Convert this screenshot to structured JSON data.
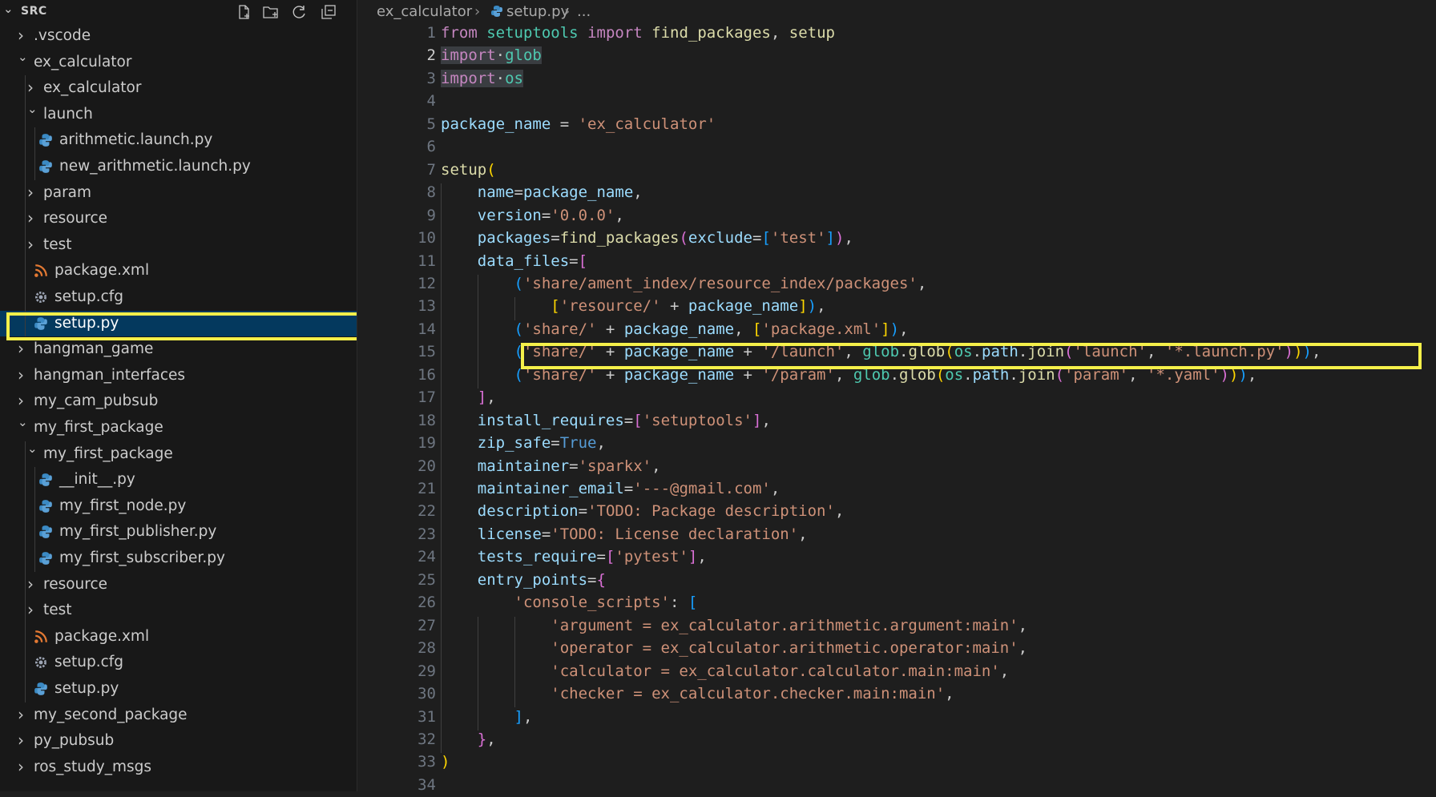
{
  "explorer": {
    "title": "SRC",
    "actions": [
      "new-file-icon",
      "new-folder-icon",
      "refresh-icon",
      "collapse-all-icon"
    ]
  },
  "tree": [
    {
      "label": ".vscode",
      "type": "folder",
      "expanded": false,
      "depth": 0
    },
    {
      "label": "ex_calculator",
      "type": "folder",
      "expanded": true,
      "depth": 0
    },
    {
      "label": "ex_calculator",
      "type": "folder",
      "expanded": false,
      "depth": 1
    },
    {
      "label": "launch",
      "type": "folder",
      "expanded": true,
      "depth": 1
    },
    {
      "label": "arithmetic.launch.py",
      "type": "py",
      "depth": 2
    },
    {
      "label": "new_arithmetic.launch.py",
      "type": "py",
      "depth": 2
    },
    {
      "label": "param",
      "type": "folder",
      "expanded": false,
      "depth": 1
    },
    {
      "label": "resource",
      "type": "folder",
      "expanded": false,
      "depth": 1
    },
    {
      "label": "test",
      "type": "folder",
      "expanded": false,
      "depth": 1
    },
    {
      "label": "package.xml",
      "type": "xml",
      "depth": 1
    },
    {
      "label": "setup.cfg",
      "type": "cfg",
      "depth": 1
    },
    {
      "label": "setup.py",
      "type": "py",
      "depth": 1,
      "selected": true
    },
    {
      "label": "hangman_game",
      "type": "folder",
      "expanded": false,
      "depth": 0
    },
    {
      "label": "hangman_interfaces",
      "type": "folder",
      "expanded": false,
      "depth": 0
    },
    {
      "label": "my_cam_pubsub",
      "type": "folder",
      "expanded": false,
      "depth": 0
    },
    {
      "label": "my_first_package",
      "type": "folder",
      "expanded": true,
      "depth": 0
    },
    {
      "label": "my_first_package",
      "type": "folder",
      "expanded": true,
      "depth": 1
    },
    {
      "label": "__init__.py",
      "type": "py",
      "depth": 2
    },
    {
      "label": "my_first_node.py",
      "type": "py",
      "depth": 2
    },
    {
      "label": "my_first_publisher.py",
      "type": "py",
      "depth": 2
    },
    {
      "label": "my_first_subscriber.py",
      "type": "py",
      "depth": 2
    },
    {
      "label": "resource",
      "type": "folder",
      "expanded": false,
      "depth": 1
    },
    {
      "label": "test",
      "type": "folder",
      "expanded": false,
      "depth": 1
    },
    {
      "label": "package.xml",
      "type": "xml",
      "depth": 1
    },
    {
      "label": "setup.cfg",
      "type": "cfg",
      "depth": 1
    },
    {
      "label": "setup.py",
      "type": "py",
      "depth": 1
    },
    {
      "label": "my_second_package",
      "type": "folder",
      "expanded": false,
      "depth": 0
    },
    {
      "label": "py_pubsub",
      "type": "folder",
      "expanded": false,
      "depth": 0
    },
    {
      "label": "ros_study_msgs",
      "type": "folder",
      "expanded": false,
      "depth": 0
    }
  ],
  "breadcrumb": {
    "folder": "ex_calculator",
    "file": "setup.py",
    "rest": "..."
  },
  "editor": {
    "active_line": 2,
    "lines": [
      [
        [
          "k",
          "from"
        ],
        [
          "p",
          " "
        ],
        [
          "m",
          "setuptools"
        ],
        [
          "p",
          " "
        ],
        [
          "k",
          "import"
        ],
        [
          "p",
          " "
        ],
        [
          "f",
          "find_packages"
        ],
        [
          "p",
          ", "
        ],
        [
          "f",
          "setup"
        ]
      ],
      [
        [
          "k",
          "import"
        ],
        [
          "p",
          "·"
        ],
        [
          "m",
          "glob"
        ]
      ],
      [
        [
          "k",
          "import"
        ],
        [
          "p",
          "·"
        ],
        [
          "m",
          "os"
        ]
      ],
      [],
      [
        [
          "v",
          "package_name"
        ],
        [
          "p",
          " = "
        ],
        [
          "s",
          "'ex_calculator'"
        ]
      ],
      [],
      [
        [
          "f",
          "setup"
        ],
        [
          "b1",
          "("
        ]
      ],
      [
        [
          "p",
          "    "
        ],
        [
          "v",
          "name"
        ],
        [
          "p",
          "="
        ],
        [
          "v",
          "package_name"
        ],
        [
          "p",
          ","
        ]
      ],
      [
        [
          "p",
          "    "
        ],
        [
          "v",
          "version"
        ],
        [
          "p",
          "="
        ],
        [
          "s",
          "'0.0.0'"
        ],
        [
          "p",
          ","
        ]
      ],
      [
        [
          "p",
          "    "
        ],
        [
          "v",
          "packages"
        ],
        [
          "p",
          "="
        ],
        [
          "f",
          "find_packages"
        ],
        [
          "b2",
          "("
        ],
        [
          "v",
          "exclude"
        ],
        [
          "p",
          "="
        ],
        [
          "b3",
          "["
        ],
        [
          "s",
          "'test'"
        ],
        [
          "b3",
          "]"
        ],
        [
          "b2",
          ")"
        ],
        [
          "p",
          ","
        ]
      ],
      [
        [
          "p",
          "    "
        ],
        [
          "v",
          "data_files"
        ],
        [
          "p",
          "="
        ],
        [
          "b2",
          "["
        ]
      ],
      [
        [
          "p",
          "        "
        ],
        [
          "b3",
          "("
        ],
        [
          "s",
          "'share/ament_index/resource_index/packages'"
        ],
        [
          "p",
          ","
        ]
      ],
      [
        [
          "p",
          "            "
        ],
        [
          "b1",
          "["
        ],
        [
          "s",
          "'resource/'"
        ],
        [
          "p",
          " + "
        ],
        [
          "v",
          "package_name"
        ],
        [
          "b1",
          "]"
        ],
        [
          "b3",
          ")"
        ],
        [
          "p",
          ","
        ]
      ],
      [
        [
          "p",
          "        "
        ],
        [
          "b3",
          "("
        ],
        [
          "s",
          "'share/'"
        ],
        [
          "p",
          " + "
        ],
        [
          "v",
          "package_name"
        ],
        [
          "p",
          ", "
        ],
        [
          "b1",
          "["
        ],
        [
          "s",
          "'package.xml'"
        ],
        [
          "b1",
          "]"
        ],
        [
          "b3",
          ")"
        ],
        [
          "p",
          ","
        ]
      ],
      [
        [
          "p",
          "        "
        ],
        [
          "b3",
          "("
        ],
        [
          "s",
          "'share/'"
        ],
        [
          "p",
          " + "
        ],
        [
          "v",
          "package_name"
        ],
        [
          "p",
          " + "
        ],
        [
          "s",
          "'/launch'"
        ],
        [
          "p",
          ", "
        ],
        [
          "m",
          "glob"
        ],
        [
          "p",
          "."
        ],
        [
          "f",
          "glob"
        ],
        [
          "b1",
          "("
        ],
        [
          "m",
          "os"
        ],
        [
          "p",
          "."
        ],
        [
          "v",
          "path"
        ],
        [
          "p",
          "."
        ],
        [
          "f",
          "join"
        ],
        [
          "b2",
          "("
        ],
        [
          "s",
          "'launch'"
        ],
        [
          "p",
          ", "
        ],
        [
          "s",
          "'*.launch.py'"
        ],
        [
          "b2",
          ")"
        ],
        [
          "b1",
          ")"
        ],
        [
          "b3",
          ")"
        ],
        [
          "p",
          ","
        ]
      ],
      [
        [
          "p",
          "        "
        ],
        [
          "b3",
          "("
        ],
        [
          "s",
          "'share/'"
        ],
        [
          "p",
          " + "
        ],
        [
          "v",
          "package_name"
        ],
        [
          "p",
          " + "
        ],
        [
          "s",
          "'/param'"
        ],
        [
          "p",
          ", "
        ],
        [
          "m",
          "glob"
        ],
        [
          "p",
          "."
        ],
        [
          "f",
          "glob"
        ],
        [
          "b1",
          "("
        ],
        [
          "m",
          "os"
        ],
        [
          "p",
          "."
        ],
        [
          "v",
          "path"
        ],
        [
          "p",
          "."
        ],
        [
          "f",
          "join"
        ],
        [
          "b2",
          "("
        ],
        [
          "s",
          "'param'"
        ],
        [
          "p",
          ", "
        ],
        [
          "s",
          "'*.yaml'"
        ],
        [
          "b2",
          ")"
        ],
        [
          "b1",
          ")"
        ],
        [
          "b3",
          ")"
        ],
        [
          "p",
          ","
        ]
      ],
      [
        [
          "p",
          "    "
        ],
        [
          "b2",
          "]"
        ],
        [
          "p",
          ","
        ]
      ],
      [
        [
          "p",
          "    "
        ],
        [
          "v",
          "install_requires"
        ],
        [
          "p",
          "="
        ],
        [
          "b2",
          "["
        ],
        [
          "s",
          "'setuptools'"
        ],
        [
          "b2",
          "]"
        ],
        [
          "p",
          ","
        ]
      ],
      [
        [
          "p",
          "    "
        ],
        [
          "v",
          "zip_safe"
        ],
        [
          "p",
          "="
        ],
        [
          "c",
          "True"
        ],
        [
          "p",
          ","
        ]
      ],
      [
        [
          "p",
          "    "
        ],
        [
          "v",
          "maintainer"
        ],
        [
          "p",
          "="
        ],
        [
          "s",
          "'sparkx'"
        ],
        [
          "p",
          ","
        ]
      ],
      [
        [
          "p",
          "    "
        ],
        [
          "v",
          "maintainer_email"
        ],
        [
          "p",
          "="
        ],
        [
          "s",
          "'---@gmail.com'"
        ],
        [
          "p",
          ","
        ]
      ],
      [
        [
          "p",
          "    "
        ],
        [
          "v",
          "description"
        ],
        [
          "p",
          "="
        ],
        [
          "s",
          "'TODO: Package description'"
        ],
        [
          "p",
          ","
        ]
      ],
      [
        [
          "p",
          "    "
        ],
        [
          "v",
          "license"
        ],
        [
          "p",
          "="
        ],
        [
          "s",
          "'TODO: License declaration'"
        ],
        [
          "p",
          ","
        ]
      ],
      [
        [
          "p",
          "    "
        ],
        [
          "v",
          "tests_require"
        ],
        [
          "p",
          "="
        ],
        [
          "b2",
          "["
        ],
        [
          "s",
          "'pytest'"
        ],
        [
          "b2",
          "]"
        ],
        [
          "p",
          ","
        ]
      ],
      [
        [
          "p",
          "    "
        ],
        [
          "v",
          "entry_points"
        ],
        [
          "p",
          "="
        ],
        [
          "b2",
          "{"
        ]
      ],
      [
        [
          "p",
          "        "
        ],
        [
          "s",
          "'console_scripts'"
        ],
        [
          "p",
          ": "
        ],
        [
          "b3",
          "["
        ]
      ],
      [
        [
          "p",
          "            "
        ],
        [
          "s",
          "'argument = ex_calculator.arithmetic.argument:main'"
        ],
        [
          "p",
          ","
        ]
      ],
      [
        [
          "p",
          "            "
        ],
        [
          "s",
          "'operator = ex_calculator.arithmetic.operator:main'"
        ],
        [
          "p",
          ","
        ]
      ],
      [
        [
          "p",
          "            "
        ],
        [
          "s",
          "'calculator = ex_calculator.calculator.main:main'"
        ],
        [
          "p",
          ","
        ]
      ],
      [
        [
          "p",
          "            "
        ],
        [
          "s",
          "'checker = ex_calculator.checker.main:main'"
        ],
        [
          "p",
          ","
        ]
      ],
      [
        [
          "p",
          "        "
        ],
        [
          "b3",
          "]"
        ],
        [
          "p",
          ","
        ]
      ],
      [
        [
          "p",
          "    "
        ],
        [
          "b2",
          "}"
        ],
        [
          "p",
          ","
        ]
      ],
      [
        [
          "b1",
          ")"
        ]
      ],
      []
    ]
  }
}
